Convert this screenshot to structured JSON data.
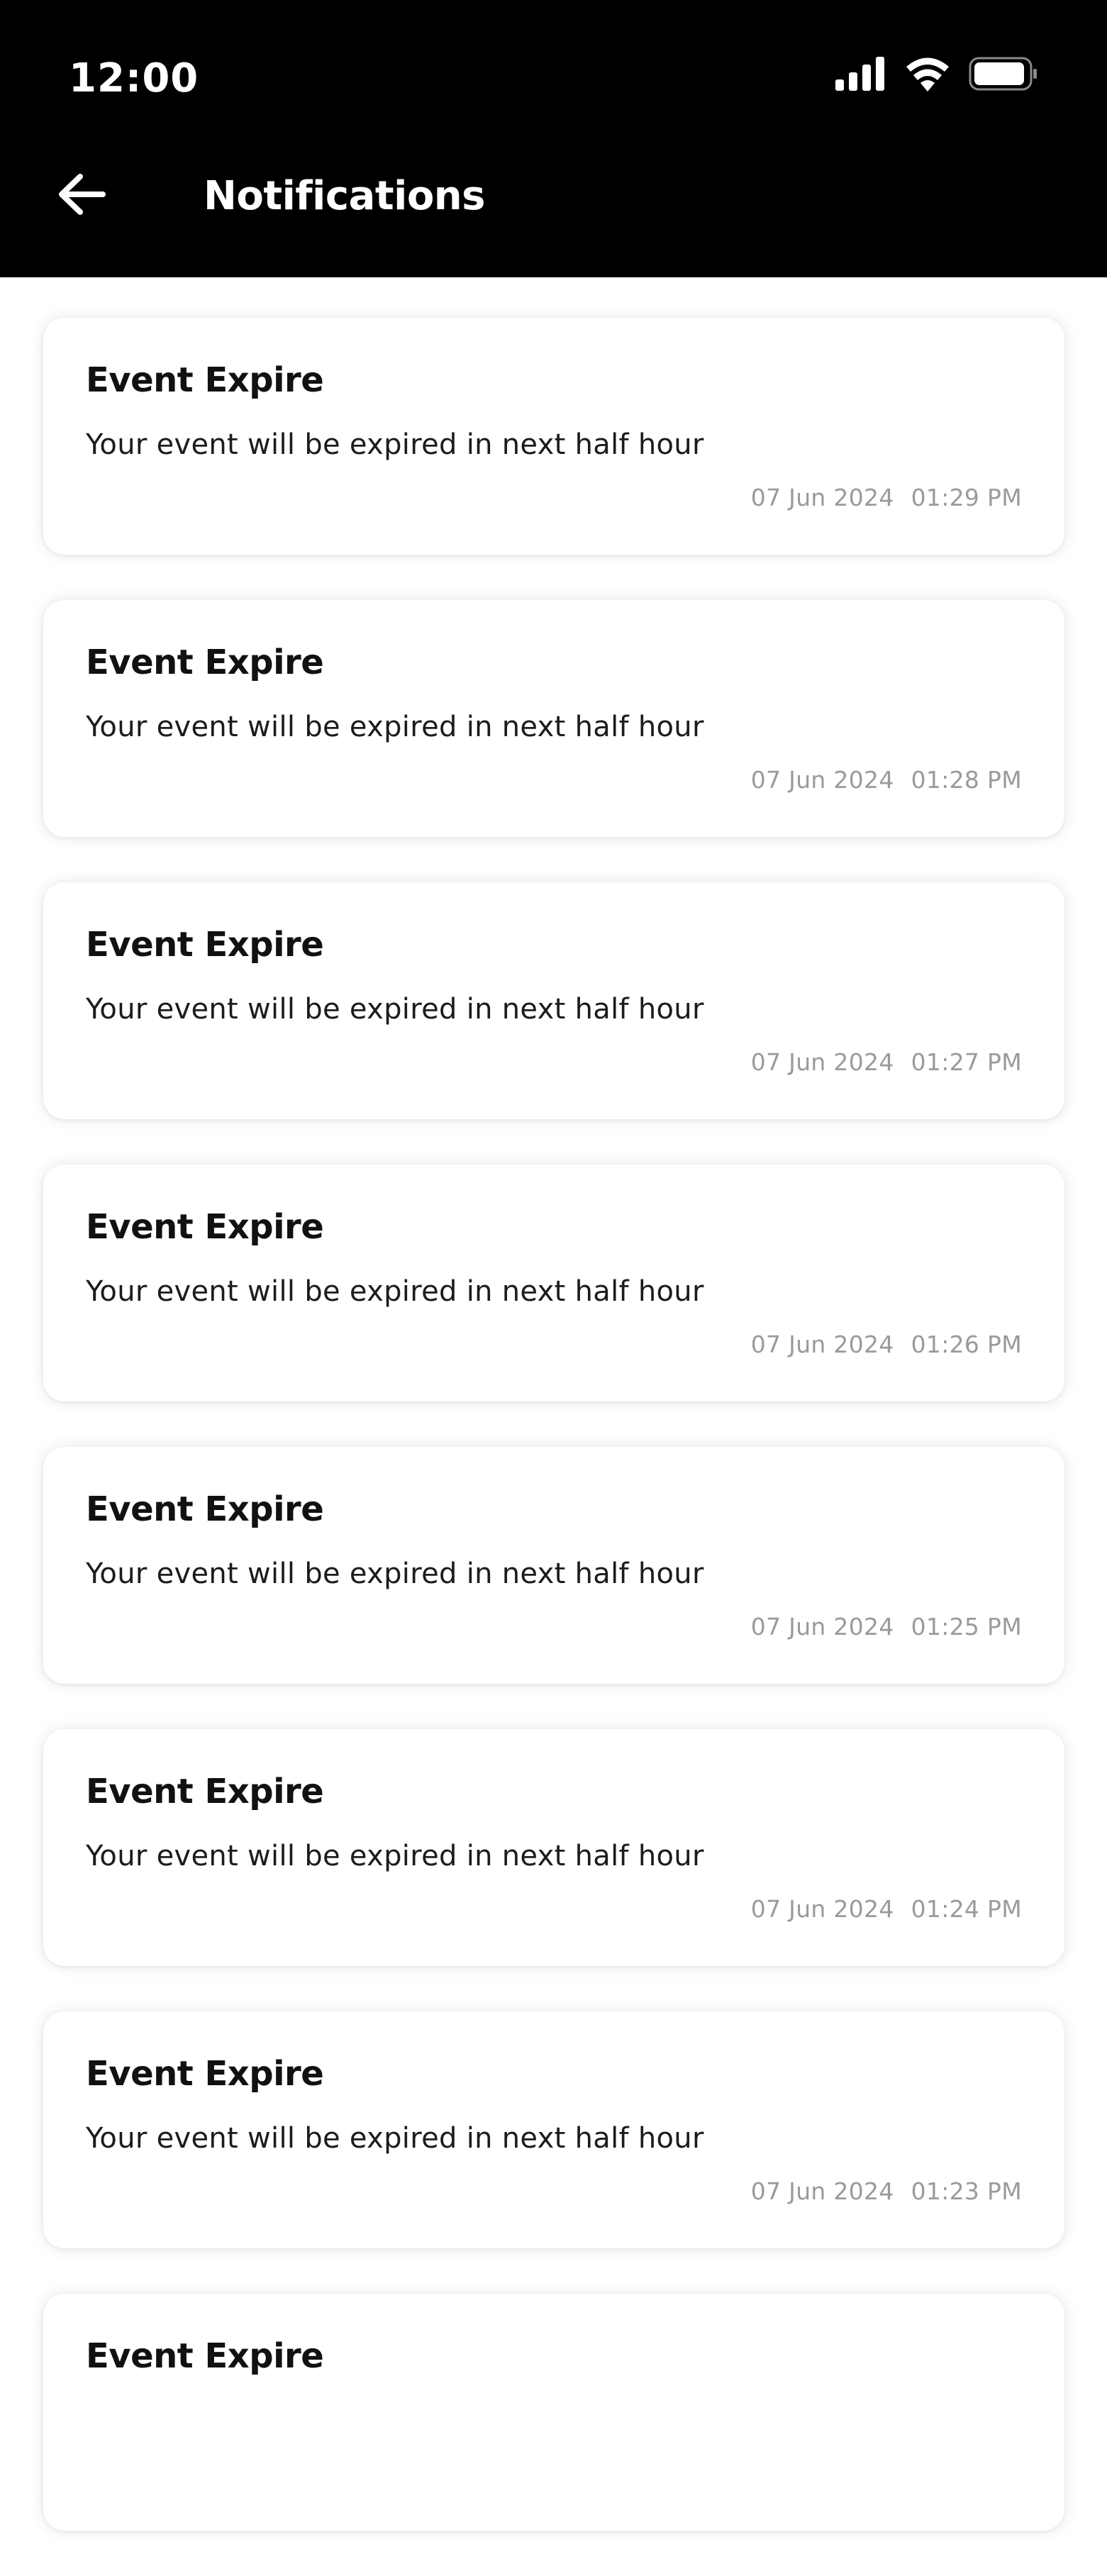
{
  "status_bar": {
    "time": "12:00",
    "icons": [
      "cellular-signal-icon",
      "wifi-icon",
      "battery-icon"
    ]
  },
  "header": {
    "back_icon": "arrow-left-icon",
    "title": "Notifications",
    "background": "#000000",
    "text_color": "#ffffff"
  },
  "notifications": [
    {
      "title": "Event Expire",
      "message": "Your event will be expired in next half hour",
      "date": "07 Jun 2024",
      "time": "01:29 PM"
    },
    {
      "title": "Event Expire",
      "message": "Your event will be expired in next half hour",
      "date": "07 Jun 2024",
      "time": "01:28 PM"
    },
    {
      "title": "Event Expire",
      "message": "Your event will be expired in next half hour",
      "date": "07 Jun 2024",
      "time": "01:27 PM"
    },
    {
      "title": "Event Expire",
      "message": "Your event will be expired in next half hour",
      "date": "07 Jun 2024",
      "time": "01:26 PM"
    },
    {
      "title": "Event Expire",
      "message": "Your event will be expired in next half hour",
      "date": "07 Jun 2024",
      "time": "01:25 PM"
    },
    {
      "title": "Event Expire",
      "message": "Your event will be expired in next half hour",
      "date": "07 Jun 2024",
      "time": "01:24 PM"
    },
    {
      "title": "Event Expire",
      "message": "Your event will be expired in next half hour",
      "date": "07 Jun 2024",
      "time": "01:23 PM"
    },
    {
      "title": "Event Expire"
    }
  ],
  "colors": {
    "card_background": "#ffffff",
    "title_text": "#111111",
    "body_text": "#1c1c1c",
    "meta_text": "#9a9a9a"
  }
}
